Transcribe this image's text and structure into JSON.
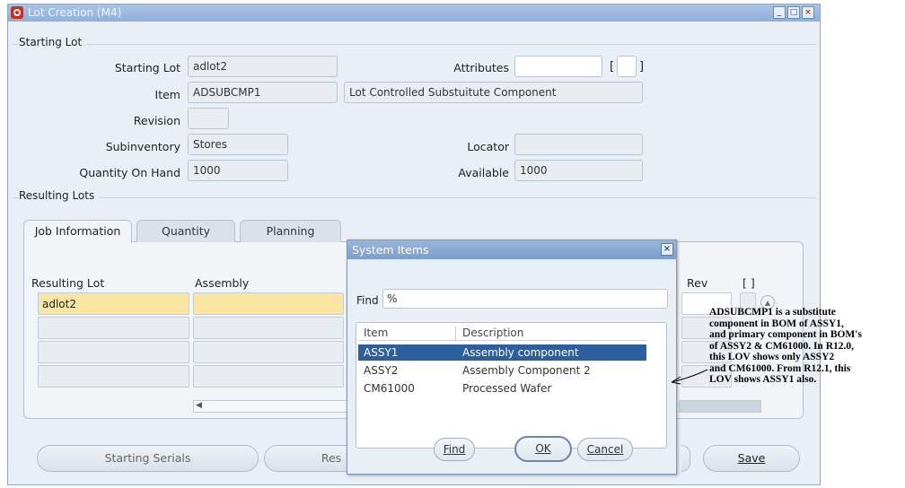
{
  "window": {
    "title": "Lot Creation (M4)"
  },
  "starting_lot_section": {
    "title": "Starting Lot",
    "starting_lot_label": "Starting Lot",
    "starting_lot_value": "adlot2",
    "item_label": "Item",
    "item_value": "ADSUBCMP1",
    "item_desc": "Lot Controlled Substuitute Component",
    "revision_label": "Revision",
    "revision_value": "",
    "subinventory_label": "Subinventory",
    "subinventory_value": "Stores",
    "qoh_label": "Quantity On Hand",
    "qoh_value": "1000",
    "attributes_label": "Attributes",
    "attributes_value": "",
    "bracket_open": "[",
    "bracket_close": "]",
    "locator_label": "Locator",
    "locator_value": "",
    "available_label": "Available",
    "available_value": "1000"
  },
  "resulting_lots_section": {
    "title": "Resulting Lots",
    "tabs": [
      "Job Information",
      "Quantity",
      "Planning"
    ],
    "columns": {
      "resulting_lot": "Resulting Lot",
      "assembly": "Assembly",
      "rev": "Rev",
      "flex": "[ ]"
    },
    "first_row_lot": "adlot2"
  },
  "buttons": {
    "starting_serials": "Starting Serials",
    "res": "Res",
    "save": "Save"
  },
  "dialog": {
    "title": "System Items",
    "find_label": "Find",
    "find_value": "%",
    "columns": [
      "Item",
      "Description"
    ],
    "rows": [
      {
        "item": "ASSY1",
        "description": "Assembly component"
      },
      {
        "item": "ASSY2",
        "description": "Assembly Component 2"
      },
      {
        "item": "CM61000",
        "description": "Processed Wafer"
      }
    ],
    "find_button": "Find",
    "ok_button": "OK",
    "cancel_button": "Cancel"
  },
  "annotation": {
    "lines": [
      "ADSUBCMP1 is a substitute",
      "component in BOM of ASSY1,",
      "and primary component  in BOM's",
      "of ASSY2 & CM61000. In R12.0,",
      "this LOV shows only ASSY2",
      "and CM61000. From R12.1, this",
      "LOV shows ASSY1 also."
    ]
  },
  "colors": {
    "titlebar": "#8fb0da",
    "selection": "#2c5f9e",
    "highlight_field": "#fbe6a1",
    "window_bg": "#e9eff4",
    "oracle_logo": "#d42b1e"
  },
  "icons": [
    "oracle-logo-icon",
    "minimize-icon",
    "maximize-icon",
    "close-icon",
    "scroll-left-icon",
    "scroll-up-icon",
    "dialog-close-icon",
    "annotation-arrow-icon"
  ]
}
